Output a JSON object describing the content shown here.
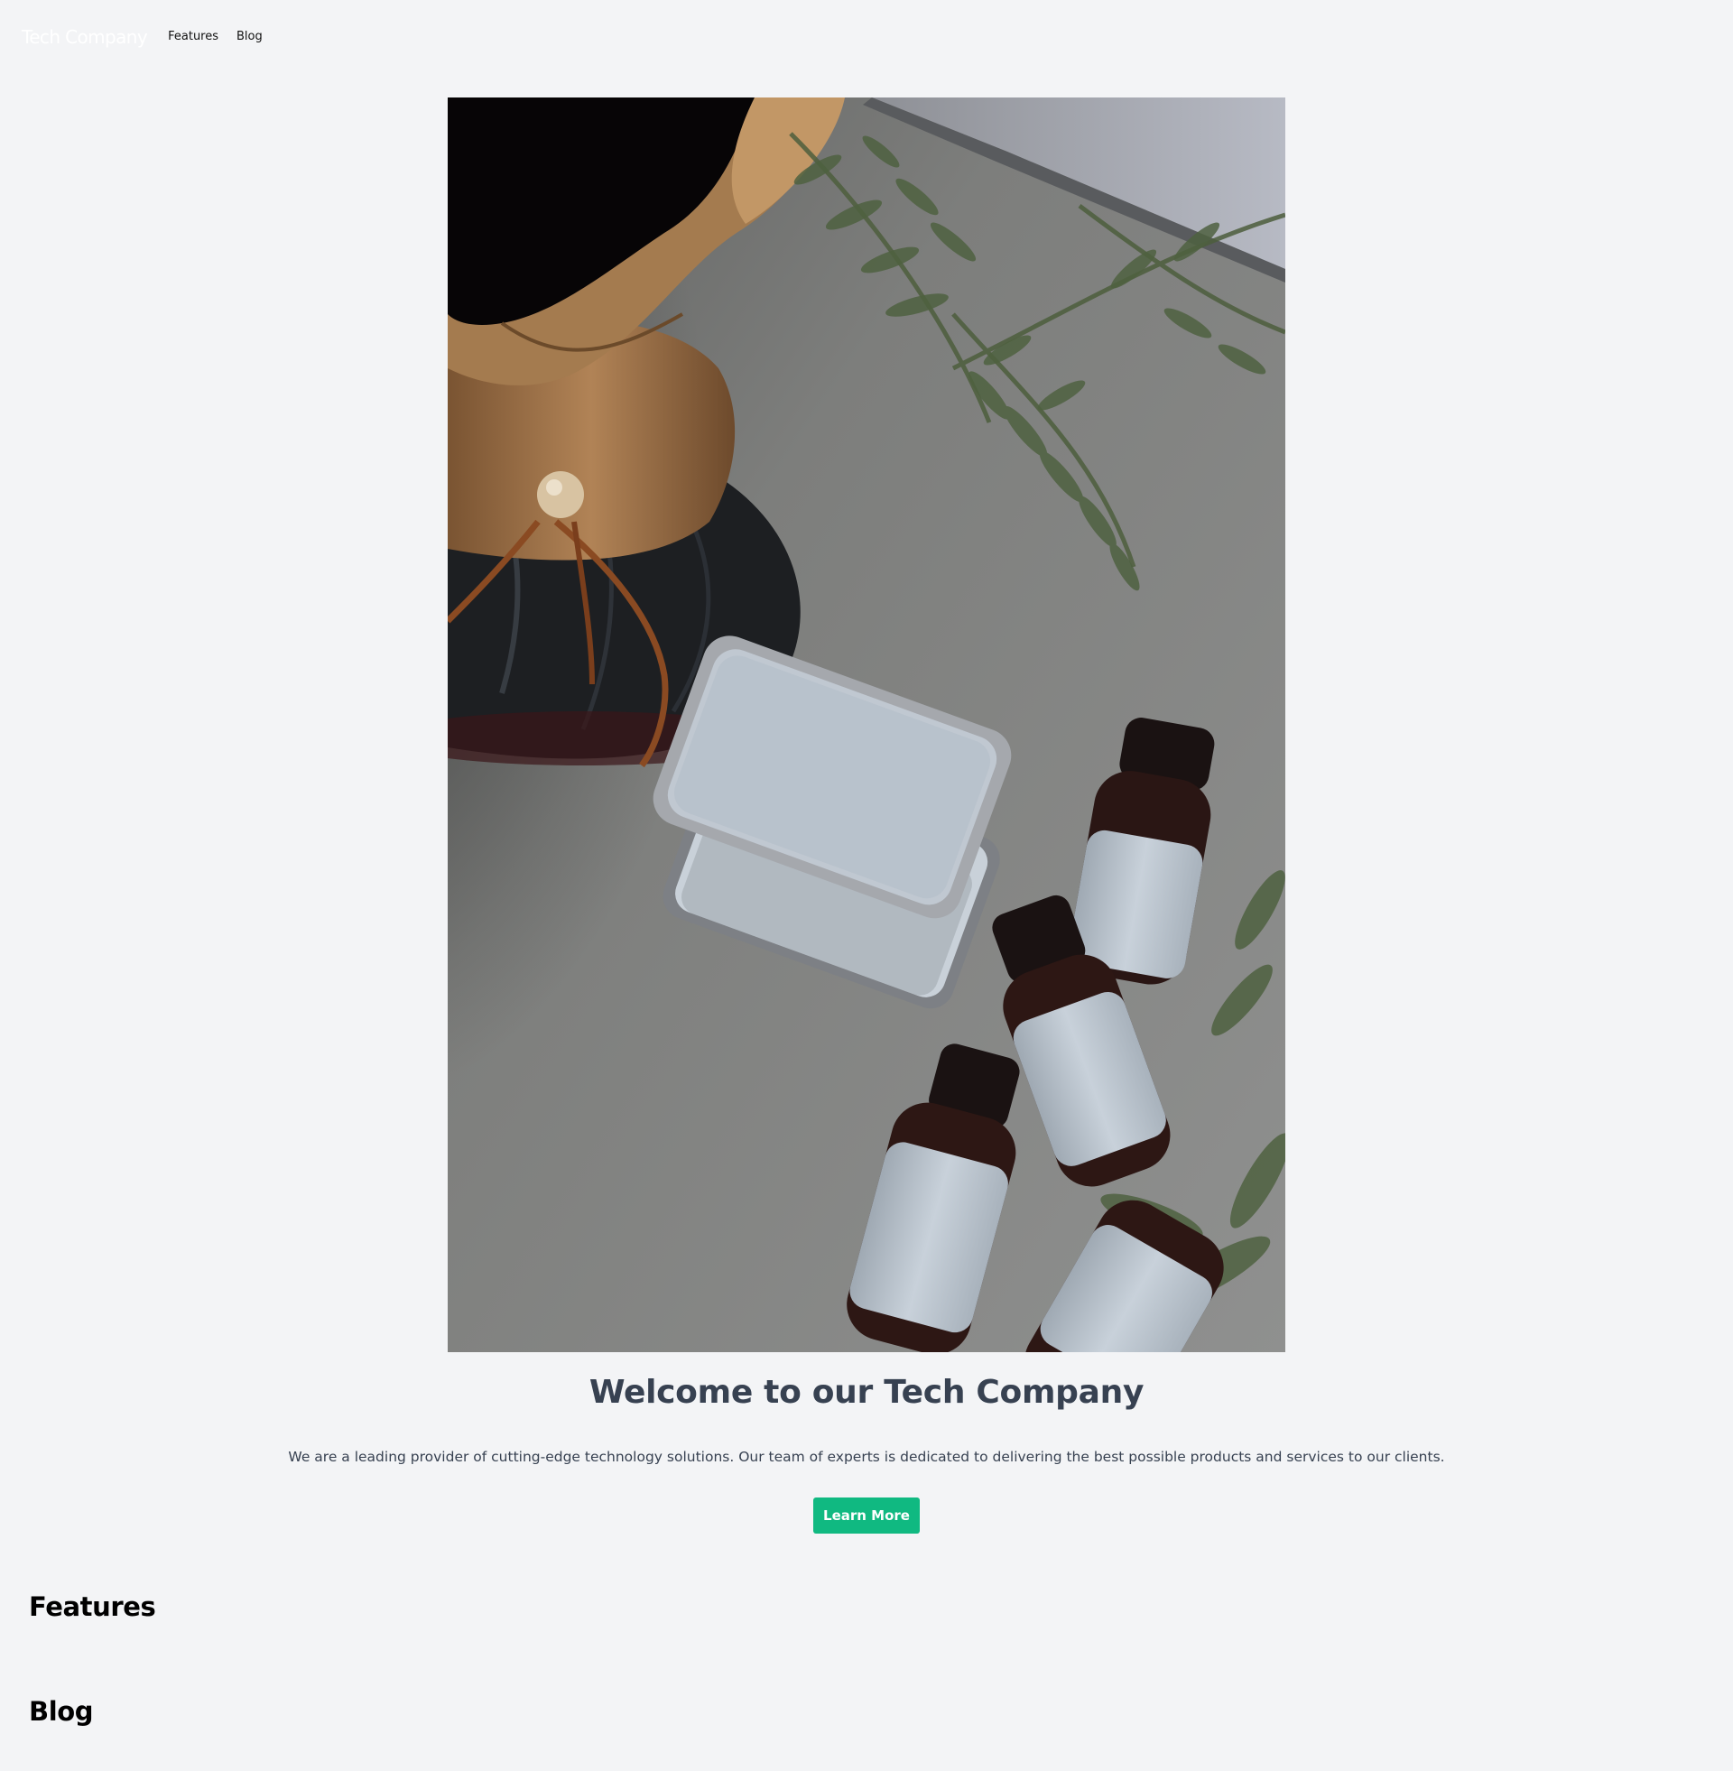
{
  "header": {
    "brand": "Tech Company",
    "nav": [
      {
        "label": "Features"
      },
      {
        "label": "Blog"
      }
    ]
  },
  "hero": {
    "image": "product-photo (coffee dripper, metal tins, amber dropper bottles, fern)",
    "title": "Welcome to our Tech Company",
    "description": "We are a leading provider of cutting-edge technology solutions. Our team of experts is dedicated to delivering the best possible products and services to our clients.",
    "cta_label": "Learn More"
  },
  "sections": {
    "features_title": "Features",
    "blog_title": "Blog"
  },
  "colors": {
    "page_background": "#f3f4f6",
    "heading_text": "#374151",
    "accent": "#10b981",
    "brand_text": "#ffffff"
  }
}
